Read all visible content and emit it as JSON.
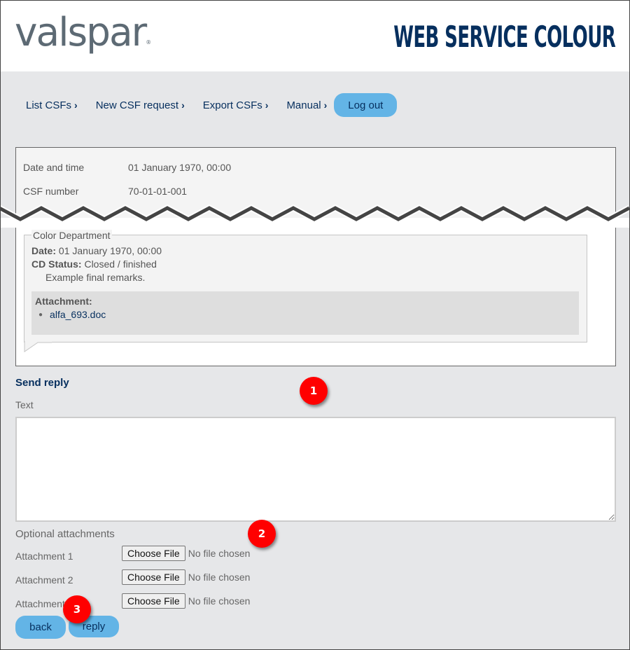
{
  "header": {
    "logo_text": "valspar",
    "logo_mark": "®",
    "app_title": "WEB SERVICE COLOUR"
  },
  "nav": {
    "items": [
      {
        "label": "List CSFs",
        "icon": "chevron-right-icon",
        "glyph": "›"
      },
      {
        "label": "New CSF request",
        "icon": "chevron-right-icon",
        "glyph": "›"
      },
      {
        "label": "Export CSFs",
        "icon": "chevron-right-icon",
        "glyph": "›"
      },
      {
        "label": "Manual",
        "icon": "chevron-right-icon",
        "glyph": "›"
      }
    ],
    "logout_label": "Log out"
  },
  "csf": {
    "fields": [
      {
        "label": "Date and time",
        "value": "01 January 1970, 00:00"
      },
      {
        "label": "CSF number",
        "value": "70-01-01-001"
      }
    ],
    "color_department": {
      "legend": "Color Department",
      "date_label": "Date:",
      "date_value": "01 January 1970, 00:00",
      "status_label": "CD Status:",
      "status_value": "Closed / finished",
      "remarks": "Example final remarks.",
      "attachment_title": "Attachment:",
      "attachments": [
        "alfa_693.doc"
      ]
    }
  },
  "reply": {
    "title": "Send reply",
    "text_label": "Text",
    "text_value": "",
    "optional_label": "Optional attachments",
    "attachments": [
      {
        "label": "Attachment 1",
        "button": "Choose File",
        "status": "No file chosen"
      },
      {
        "label": "Attachment 2",
        "button": "Choose File",
        "status": "No file chosen"
      },
      {
        "label": "Attachment 3",
        "button": "Choose File",
        "status": "No file chosen"
      }
    ],
    "back_label": "back",
    "reply_label": "reply"
  },
  "markers": [
    "1",
    "2",
    "3"
  ],
  "colors": {
    "brand_navy": "#062f5e",
    "button_blue": "#63b4e6",
    "marker_red": "#ff0000",
    "page_bg": "#e6e7e9"
  }
}
